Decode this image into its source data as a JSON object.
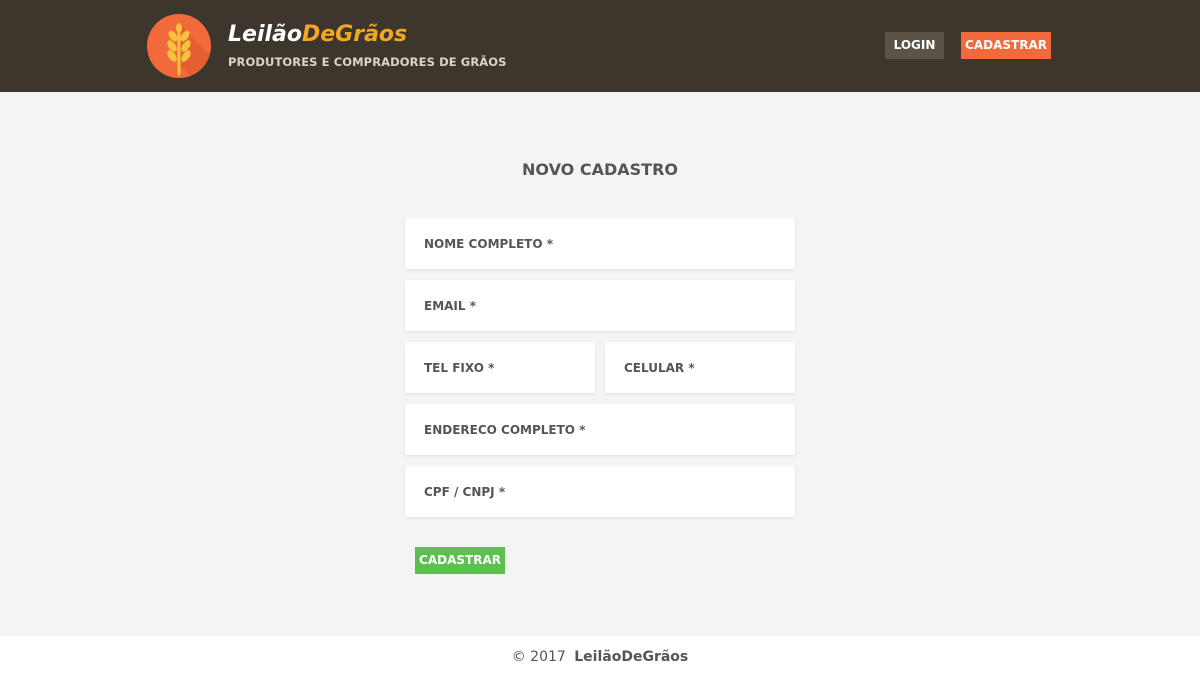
{
  "header": {
    "brand_part1": "Leilão",
    "brand_part2": "De",
    "brand_part3": "Grãos",
    "tagline": "PRODUTORES E COMPRADORES DE GRÃOS",
    "login_label": "LOGIN",
    "register_label": "CADASTRAR",
    "logo_icon": "wheat-icon"
  },
  "main": {
    "title": "NOVO CADASTRO",
    "fields": {
      "nome": {
        "placeholder": "NOME COMPLETO *",
        "value": ""
      },
      "email": {
        "placeholder": "EMAIL *",
        "value": ""
      },
      "tel": {
        "placeholder": "TEL FIXO *",
        "value": ""
      },
      "celular": {
        "placeholder": "CELULAR *",
        "value": ""
      },
      "endereco": {
        "placeholder": "ENDERECO COMPLETO *",
        "value": ""
      },
      "cpf": {
        "placeholder": "CPF / CNPJ *",
        "value": ""
      }
    },
    "submit_label": "CADASTRAR"
  },
  "footer": {
    "copyright": "© 2017",
    "brand": "LeilãoDeGrãos"
  },
  "colors": {
    "header_bg": "#3d362c",
    "accent_orange": "#f26a3b",
    "accent_yellow": "#f5a623",
    "login_bg": "#5b5346",
    "submit_green": "#5cc04f",
    "page_bg": "#f4f4f4"
  }
}
